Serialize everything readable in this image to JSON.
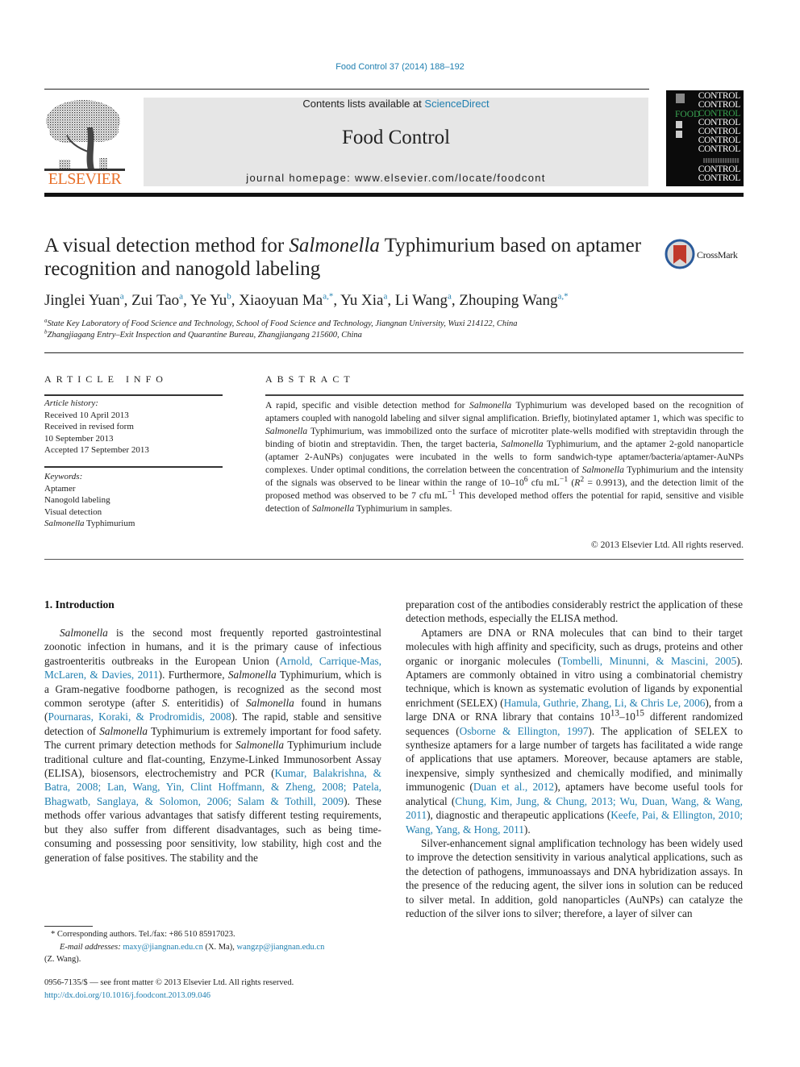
{
  "header": {
    "citation": "Food Control 37 (2014) 188–192",
    "contents_prefix": "Contents lists available at ",
    "contents_link": "ScienceDirect",
    "journal_title": "Food Control",
    "homepage": "journal homepage: www.elsevier.com/locate/foodcont",
    "publisher_logo": "ELSEVIER",
    "cover": {
      "rows": [
        "CONTROL",
        "CONTROL",
        "CONTROL",
        "CONTROL",
        "CONTROL",
        "CONTROL",
        "CONTROL",
        "CONTROL",
        "CONTROL"
      ],
      "food_label": "FOOD",
      "food_color": "#3aa552"
    },
    "crossmark": "CrossMark"
  },
  "article": {
    "title_part1": "A visual detection method for ",
    "title_italic": "Salmonella",
    "title_part2": " Typhimurium based on aptamer recognition and nanogold labeling",
    "authors": [
      {
        "name": "Jinglei Yuan",
        "aff": "a"
      },
      {
        "name": "Zui Tao",
        "aff": "a"
      },
      {
        "name": "Ye Yu",
        "aff": "b"
      },
      {
        "name": "Xiaoyuan Ma",
        "aff": "a,*"
      },
      {
        "name": "Yu Xia",
        "aff": "a"
      },
      {
        "name": "Li Wang",
        "aff": "a"
      },
      {
        "name": "Zhouping Wang",
        "aff": "a,*"
      }
    ],
    "affiliations": [
      {
        "mark": "a",
        "text": "State Key Laboratory of Food Science and Technology, School of Food Science and Technology, Jiangnan University, Wuxi 214122, China"
      },
      {
        "mark": "b",
        "text": "Zhangjiagang Entry–Exit Inspection and Quarantine Bureau, Zhangjiangang 215600, China"
      }
    ]
  },
  "article_info": {
    "heading": "ARTICLE INFO",
    "history_label": "Article history:",
    "history": [
      "Received 10 April 2013",
      "Received in revised form",
      "10 September 2013",
      "Accepted 17 September 2013"
    ],
    "keywords_label": "Keywords:",
    "keywords": [
      "Aptamer",
      "Nanogold labeling",
      "Visual detection"
    ],
    "keyword_last_italic": "Salmonella",
    "keyword_last_rest": " Typhimurium"
  },
  "abstract": {
    "heading": "ABSTRACT",
    "s1": "A rapid, specific and visible detection method for ",
    "s2": " Typhimurium was developed based on the recognition of aptamers coupled with nanogold labeling and silver signal amplification. Briefly, biotinylated aptamer 1, which was specific to ",
    "s3": " Typhimurium, was immobilized onto the surface of microtiter plate-wells modified with streptavidin through the binding of biotin and streptavidin. Then, the target bacteria, ",
    "s4": " Typhimurium, and the aptamer 2-gold nanoparticle (aptamer 2-AuNPs) conjugates were incubated in the wells to form sandwich-type aptamer/bacteria/aptamer-AuNPs complexes. Under optimal conditions, the correlation between the concentration of ",
    "s5": " Typhimurium and the intensity of the signals was observed to be linear within the range of 10–10",
    "exp6": "6",
    "s6": " cfu mL",
    "exp_neg1": "−1",
    "s7": " (",
    "r": "R",
    "exp2": "2",
    "s8": " = 0.9913), and the detection limit of the proposed method was observed to be 7 cfu mL",
    "s9": " This developed method offers the potential for rapid, sensitive and visible detection of ",
    "s10": " Typhimurium in samples.",
    "genus": "Salmonella",
    "copyright": "© 2013 Elsevier Ltd. All rights reserved."
  },
  "intro": {
    "heading": "1.  Introduction",
    "genus": "Salmonella",
    "p1": {
      "a": " is the second most frequently reported gastrointestinal zoonotic infection in humans, and it is the primary cause of infectious gastroenteritis outbreaks in the European Union (",
      "ref1": "Arnold, Carrique-Mas, McLaren, & Davies, 2011",
      "b": "). Furthermore, ",
      "c": " Typhimurium, which is a Gram-negative foodborne pathogen, is recognized as the second most common serotype (after ",
      "s_ent": "S.",
      "d": " enteritidis) of ",
      "e": " found in humans (",
      "ref2": "Pournaras, Koraki, & Prodromidis, 2008",
      "f": "). The rapid, stable and sensitive detection of ",
      "g": " Typhimurium is extremely important for food safety. The current primary detection methods for ",
      "h": " Typhimurium include traditional culture and flat-counting, Enzyme-Linked Immunosorbent Assay (ELISA), biosensors, electrochemistry and PCR (",
      "ref3": "Kumar, Balakrishna, & Batra, 2008; Lan, Wang, Yin, Clint Hoffmann, & Zheng, 2008; Patela, Bhagwatb, Sanglaya, & Solomon, 2006; Salam & Tothill, 2009",
      "i": "). These methods offer various advantages that satisfy different testing requirements, but they also suffer from different disadvantages, such as being time-consuming and possessing poor sensitivity, low stability, high cost and the generation of false positives. The stability and the preparation cost of the antibodies considerably restrict the application of these detection methods, especially the ELISA method."
    },
    "p2": {
      "a": "Aptamers are DNA or RNA molecules that can bind to their target molecules with high affinity and specificity, such as drugs, proteins and other organic or inorganic molecules (",
      "ref1": "Tombelli, Minunni, & Mascini, 2005",
      "b": "). Aptamers are commonly obtained in vitro using a combinatorial chemistry technique, which is known as systematic evolution of ligands by exponential enrichment (SELEX) (",
      "ref2": "Hamula, Guthrie, Zhang, Li, & Chris Le, 2006",
      "c": "), from a large DNA or RNA library that contains 10",
      "exp13": "13",
      "d": "–10",
      "exp15": "15",
      "e": " different randomized sequences (",
      "ref3": "Osborne & Ellington, 1997",
      "f": "). The application of SELEX to synthesize aptamers for a large number of targets has facilitated a wide range of applications that use aptamers. Moreover, because aptamers are stable, inexpensive, simply synthesized and chemically modified, and minimally immunogenic (",
      "ref4": "Duan et al., 2012",
      "g": "), aptamers have become useful tools for analytical (",
      "ref5": "Chung, Kim, Jung, & Chung, 2013; Wu, Duan, Wang, & Wang, 2011",
      "h": "), diagnostic and therapeutic applications (",
      "ref6": "Keefe, Pai, & Ellington, 2010; Wang, Yang, & Hong, 2011",
      "i": ")."
    },
    "p3": "Silver-enhancement signal amplification technology has been widely used to improve the detection sensitivity in various analytical applications, such as the detection of pathogens, immunoassays and DNA hybridization assays. In the presence of the reducing agent, the silver ions in solution can be reduced to silver metal. In addition, gold nanoparticles (AuNPs) can catalyze the reduction of the silver ions to silver; therefore, a layer of silver can"
  },
  "footnotes": {
    "corresponding": "* Corresponding authors. Tel./fax: +86 510 85917023.",
    "email_label": "E-mail addresses:",
    "email1": "maxy@jiangnan.edu.cn",
    "email1_owner": " (X. Ma), ",
    "email2": "wangzp@jiangnan.edu.cn",
    "email2_owner": "(Z. Wang).",
    "issn": "0956-7135/$ — see front matter © 2013 Elsevier Ltd. All rights reserved.",
    "doi": "http://dx.doi.org/10.1016/j.foodcont.2013.09.046"
  },
  "colors": {
    "link": "#1f7fb0",
    "elsevier_orange": "#e8702a",
    "banner_bg": "#e6e6e6"
  }
}
